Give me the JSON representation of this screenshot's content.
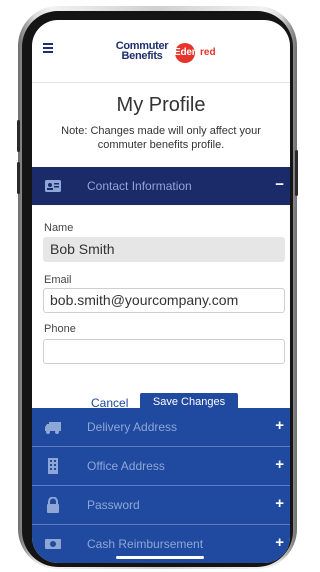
{
  "header": {
    "logo_line1": "Commuter",
    "logo_line2": "Benefits",
    "logo_brand_a": "Eden",
    "logo_brand_b": "red"
  },
  "page": {
    "title": "My Profile",
    "note": "Note: Changes made will only affect your commuter benefits profile."
  },
  "sections": [
    {
      "label": "Contact Information",
      "toggle": "−",
      "icon": "id-card-icon",
      "expanded": true
    },
    {
      "label": "Delivery Address",
      "toggle": "+",
      "icon": "truck-icon",
      "expanded": false
    },
    {
      "label": "Office Address",
      "toggle": "+",
      "icon": "building-icon",
      "expanded": false
    },
    {
      "label": "Password",
      "toggle": "+",
      "icon": "lock-icon",
      "expanded": false
    },
    {
      "label": "Cash Reimbursement",
      "toggle": "+",
      "icon": "cash-icon",
      "expanded": false
    }
  ],
  "form": {
    "name_label": "Name",
    "name_value": "Bob Smith",
    "email_label": "Email",
    "email_value": "bob.smith@yourcompany.com",
    "phone_label": "Phone",
    "phone_value": "",
    "cancel_label": "Cancel",
    "save_label": "Save Changes"
  },
  "colors": {
    "brand_blue": "#2049a0",
    "active_blue": "#1b2a68",
    "brand_red": "#e6342b"
  }
}
